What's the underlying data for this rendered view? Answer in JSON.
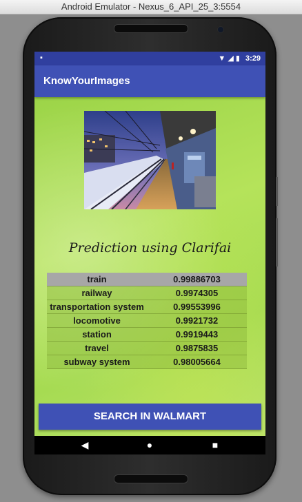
{
  "window": {
    "title": "Android Emulator - Nexus_6_API_25_3:5554"
  },
  "status_bar": {
    "time": "3:29",
    "sd_icon": "sd-card-icon",
    "wifi_icon": "wifi-icon",
    "signal_icon": "signal-icon",
    "battery_icon": "battery-icon"
  },
  "app_bar": {
    "title": "KnowYourImages"
  },
  "image": {
    "description_icon": "train-station-photo"
  },
  "heading": "Prediction using Clarifai",
  "predictions": [
    {
      "name": "train",
      "score": "0.99886703"
    },
    {
      "name": "railway",
      "score": "0.9974305"
    },
    {
      "name": "transportation system",
      "score": "0.99553996"
    },
    {
      "name": "locomotive",
      "score": "0.9921732"
    },
    {
      "name": "station",
      "score": "0.9919443"
    },
    {
      "name": "travel",
      "score": "0.9875835"
    },
    {
      "name": "subway system",
      "score": "0.98005664"
    }
  ],
  "button": {
    "label": "SEARCH IN WALMART"
  },
  "nav": {
    "back": "◀",
    "home": "●",
    "recent": "■"
  },
  "colors": {
    "primary": "#3f51b5",
    "primary_dark": "#303f9f",
    "background_green": "#a6db52",
    "header_row": "#a7a7a7"
  }
}
